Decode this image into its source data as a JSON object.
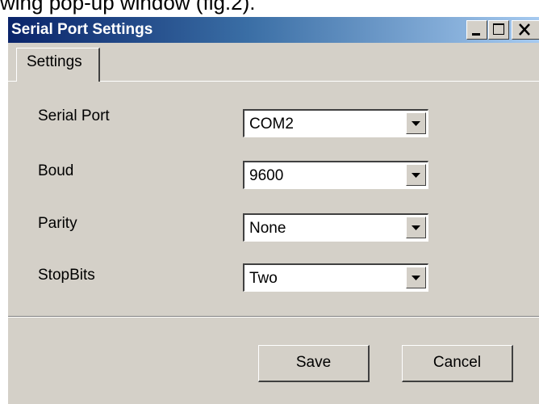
{
  "caption": "wing pop-up window (fig.2).",
  "window": {
    "title": "Serial Port Settings",
    "tabs": [
      {
        "label": "Settings"
      }
    ]
  },
  "fields": [
    {
      "label": "Serial Port",
      "value": "COM2"
    },
    {
      "label": "Boud",
      "value": "9600"
    },
    {
      "label": "Parity",
      "value": "None"
    },
    {
      "label": "StopBits",
      "value": "Two"
    }
  ],
  "buttons": {
    "save": "Save",
    "cancel": "Cancel"
  },
  "icons": {
    "minimize": "minimize-icon",
    "maximize": "maximize-icon",
    "close": "close-icon",
    "dropdown": "dropdown-arrow-icon"
  },
  "colors": {
    "title_gradient_start": "#0a246a",
    "title_gradient_end": "#a6caf0",
    "face": "#d4d0c8"
  }
}
